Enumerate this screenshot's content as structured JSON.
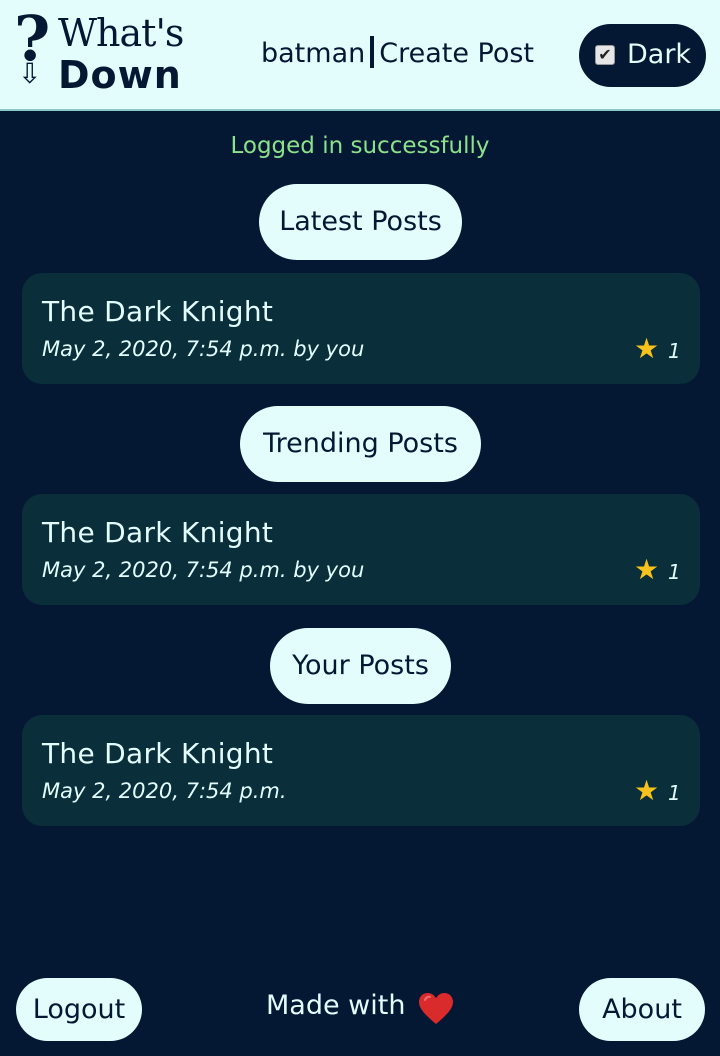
{
  "header": {
    "logo_text_top": "What's",
    "logo_text_bottom": "Down",
    "username": "batman",
    "create_post": "Create Post",
    "dark_toggle_label": "Dark",
    "dark_toggle_checked": true
  },
  "flash_message": "Logged in successfully",
  "sections": [
    {
      "title": "Latest Posts",
      "posts": [
        {
          "title": "The Dark Knight",
          "meta": "May 2, 2020, 7:54 p.m. by you",
          "stars": "1"
        }
      ]
    },
    {
      "title": "Trending Posts",
      "posts": [
        {
          "title": "The Dark Knight",
          "meta": "May 2, 2020, 7:54 p.m. by you",
          "stars": "1"
        }
      ]
    },
    {
      "title": "Your Posts",
      "posts": [
        {
          "title": "The Dark Knight",
          "meta": "May 2, 2020, 7:54 p.m.",
          "stars": "1"
        }
      ]
    }
  ],
  "footer": {
    "logout_label": "Logout",
    "made_with": "Made with",
    "about_label": "About"
  },
  "colors": {
    "background": "#041833",
    "accent_light": "#e3fdfd",
    "card": "#0a2e3a",
    "success": "#8be28b",
    "star": "#f7c21b",
    "heart": "#d92b2b"
  },
  "icons": {
    "logo": "question-arrow-logo-icon",
    "checkbox": "checkbox-checked-icon",
    "star": "star-icon",
    "heart": "heart-icon"
  }
}
